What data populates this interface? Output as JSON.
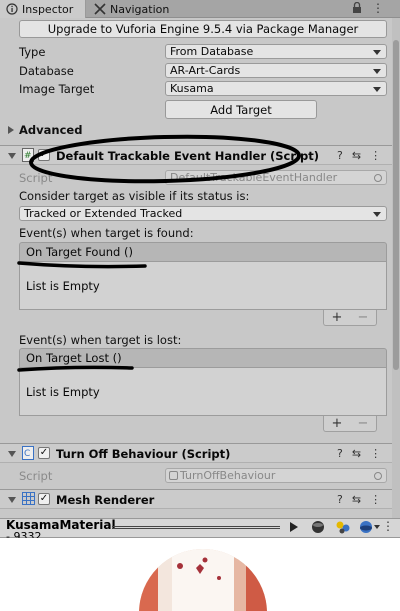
{
  "tabs": {
    "inspector": "Inspector",
    "navigation": "Navigation"
  },
  "upgrade_button": "Upgrade to Vuforia Engine 9.5.4 via Package Manager",
  "image_target": {
    "type_label": "Type",
    "type_value": "From Database",
    "database_label": "Database",
    "database_value": "AR-Art-Cards",
    "image_target_label": "Image Target",
    "image_target_value": "Kusama",
    "add_target": "Add Target",
    "advanced": "Advanced"
  },
  "event_handler": {
    "title": "Default Trackable Event Handler (Script)",
    "script_label": "Script",
    "script_value": "DefaultTrackableEventHandler",
    "consider_label": "Consider target as visible if its status is:",
    "status_value": "Tracked or Extended Tracked",
    "found_label": "Event(s) when target is found:",
    "found_event": "On Target Found ()",
    "found_empty": "List is Empty",
    "lost_label": "Event(s) when target is lost:",
    "lost_event": "On Target Lost ()",
    "lost_empty": "List is Empty",
    "plus": "+",
    "minus": "−"
  },
  "turn_off": {
    "title": "Turn Off Behaviour (Script)",
    "script_label": "Script",
    "script_value": "TurnOffBehaviour"
  },
  "mesh_renderer": {
    "title": "Mesh Renderer"
  },
  "preview": {
    "material_name": "KusamaMaterial",
    "id_fragment": "- 9332"
  },
  "header_icons": {
    "help": "?",
    "preset": "⇆",
    "menu": "⋮"
  },
  "colors": {
    "annotation": "#000000",
    "accent_blue": "#3a72c4"
  }
}
